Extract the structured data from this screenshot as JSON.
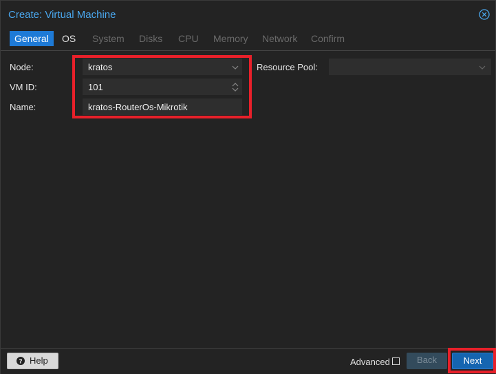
{
  "window": {
    "title": "Create: Virtual Machine",
    "close_icon": "close-circle-icon"
  },
  "tabs": [
    {
      "label": "General",
      "state": "active"
    },
    {
      "label": "OS",
      "state": "enabled"
    },
    {
      "label": "System",
      "state": "disabled"
    },
    {
      "label": "Disks",
      "state": "disabled"
    },
    {
      "label": "CPU",
      "state": "disabled"
    },
    {
      "label": "Memory",
      "state": "disabled"
    },
    {
      "label": "Network",
      "state": "disabled"
    },
    {
      "label": "Confirm",
      "state": "disabled"
    }
  ],
  "form": {
    "node": {
      "label": "Node:",
      "value": "kratos"
    },
    "vmid": {
      "label": "VM ID:",
      "value": "101"
    },
    "name": {
      "label": "Name:",
      "value": "kratos-RouterOs-Mikrotik"
    },
    "resource_pool": {
      "label": "Resource Pool:",
      "value": ""
    }
  },
  "footer": {
    "help_label": "Help",
    "advanced_label": "Advanced",
    "advanced_checked": false,
    "back_label": "Back",
    "next_label": "Next"
  },
  "colors": {
    "accent": "#1e7ad6",
    "title": "#4aa7ee",
    "highlight": "#e8202a",
    "background": "#232323"
  }
}
